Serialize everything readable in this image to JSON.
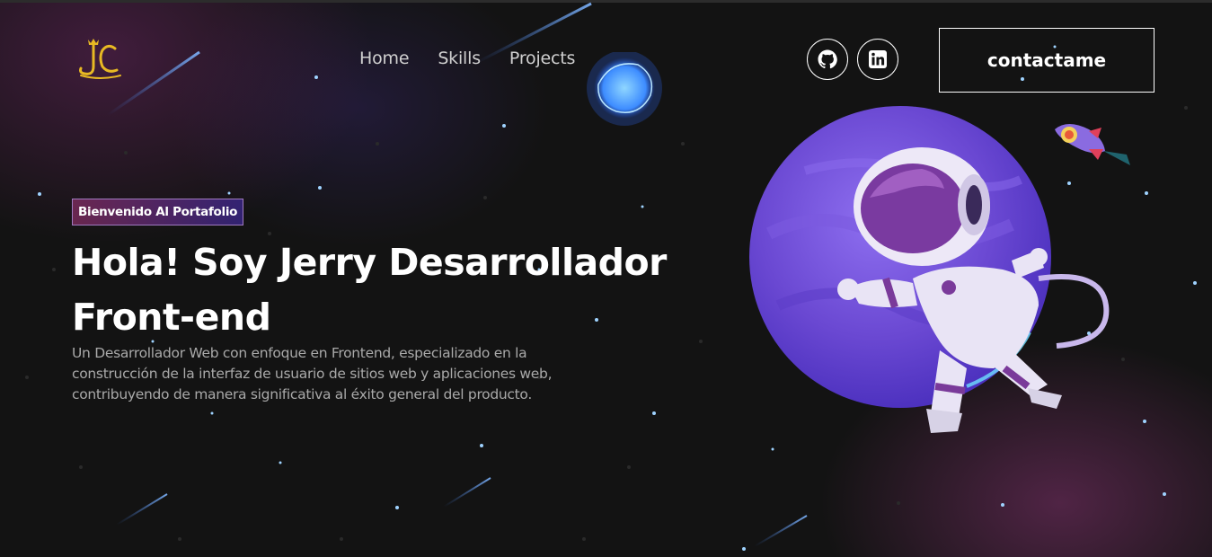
{
  "nav": {
    "links": [
      "Home",
      "Skills",
      "Projects"
    ],
    "contact_label": "contactame"
  },
  "social": {
    "github_icon": "github-icon",
    "linkedin_icon": "linkedin-icon"
  },
  "hero": {
    "badge": "Bienvenido Al Portafolio",
    "headline_line1": "Hola! Soy Jerry Desarrollador",
    "headline_line2": "Front-end",
    "description_line1": "Un Desarrollador Web con enfoque en Frontend, especializado en la",
    "description_line2": "construcción de la interfaz de usuario de sitios web y aplicaciones web,",
    "description_line3": "contribuyendo de manera significativa al éxito general del producto."
  },
  "colors": {
    "background": "#131313",
    "logo_gold": "#e8b923",
    "badge_gradient_start": "#aa367c",
    "badge_gradient_end": "#4a2fbd",
    "planet": "#6f4fd8"
  }
}
